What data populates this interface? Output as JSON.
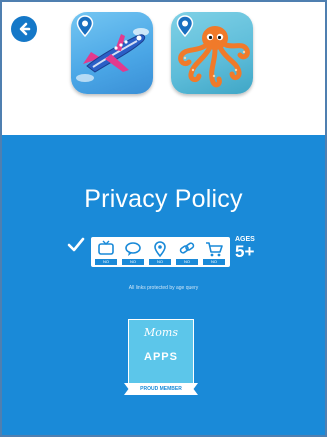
{
  "header": {
    "back_icon": "arrow-left-icon",
    "apps": [
      {
        "name": "airplane-app",
        "icon": "airplane-icon"
      },
      {
        "name": "octopus-app",
        "icon": "octopus-icon"
      }
    ]
  },
  "policy": {
    "title": "Privacy Policy",
    "badges": [
      "NO",
      "NO",
      "NO",
      "NO",
      "NO"
    ],
    "ages_label": "AGES",
    "ages_value": "5+",
    "note": "All links protected by age query"
  },
  "moms": {
    "script": "Moms",
    "title": "APPS",
    "ribbon": "PROUD MEMBER"
  },
  "colors": {
    "accent": "#1a8ad8",
    "frame": "#4f7fb0",
    "back": "#1578c8",
    "badge_card": "#5cc6ea"
  }
}
